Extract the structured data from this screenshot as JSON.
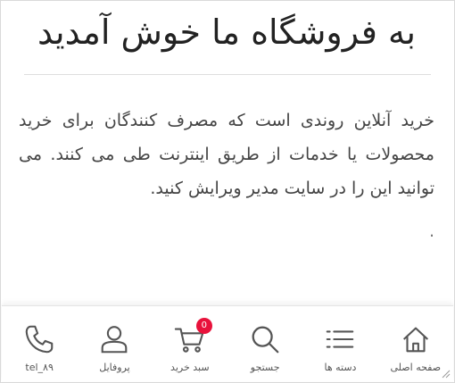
{
  "page": {
    "title": "به فروشگاه ما خوش آمدید",
    "paragraph": "خرید آنلاین روندی است که مصرف کنندگان برای خرید محصولات یا خدمات از طریق اینترنت طی می کنند. می توانید این را در سایت مدیر ویرایش کنید.",
    "peek": "."
  },
  "tabbar": {
    "items": [
      {
        "label": "صفحه اصلی",
        "icon": "home-icon"
      },
      {
        "label": "دسته ها",
        "icon": "list-icon"
      },
      {
        "label": "جستجو",
        "icon": "search-icon"
      },
      {
        "label": "سبد خرید",
        "icon": "cart-icon",
        "badge": "0"
      },
      {
        "label": "پروفایل",
        "icon": "user-icon"
      },
      {
        "label": "tel_۸۹",
        "icon": "phone-icon"
      }
    ],
    "icon_color": "#555555",
    "badge_color": "#e8123b"
  }
}
